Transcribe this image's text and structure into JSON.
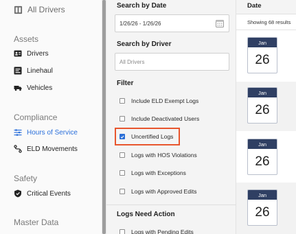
{
  "sidebar": {
    "top_item": {
      "label": "All Drivers",
      "icon": "id-card-icon"
    },
    "sections": {
      "assets": "Assets",
      "compliance": "Compliance",
      "safety": "Safety",
      "master_data": "Master Data"
    },
    "items": {
      "drivers": "Drivers",
      "linehaul": "Linehaul",
      "vehicles": "Vehicles",
      "hours_of_service": "Hours of Service",
      "eld_movements": "ELD Movements",
      "critical_events": "Critical Events"
    },
    "active_color": "#2a6fdb"
  },
  "filter_panel": {
    "search_by_date_label": "Search by Date",
    "date_range_value": "1/26/26 - 1/26/26",
    "search_by_driver_label": "Search by Driver",
    "driver_placeholder": "All Drivers",
    "filter_label": "Filter",
    "filters": [
      {
        "label": "Include ELD Exempt Logs",
        "checked": false
      },
      {
        "label": "Include Deactivated Users",
        "checked": false
      },
      {
        "label": "Uncertified Logs",
        "checked": true
      },
      {
        "label": "Logs with HOS Violations",
        "checked": false
      },
      {
        "label": "Logs with Exceptions",
        "checked": false
      },
      {
        "label": "Logs with Approved Edits",
        "checked": false
      }
    ],
    "logs_need_action_label": "Logs Need Action",
    "need_action_filters": [
      {
        "label": "Logs with Pending Edits",
        "checked": false
      }
    ],
    "highlight_color": "#e8552d",
    "checkbox_color": "#2c6fd6"
  },
  "results": {
    "column_header": "Date",
    "count_text": "Showing 68 results",
    "rows": [
      {
        "month": "Jan",
        "day": "26"
      },
      {
        "month": "Jan",
        "day": "26"
      },
      {
        "month": "Jan",
        "day": "26"
      },
      {
        "month": "Jan",
        "day": "26"
      }
    ],
    "calendar_header_color": "#2f3f63"
  }
}
